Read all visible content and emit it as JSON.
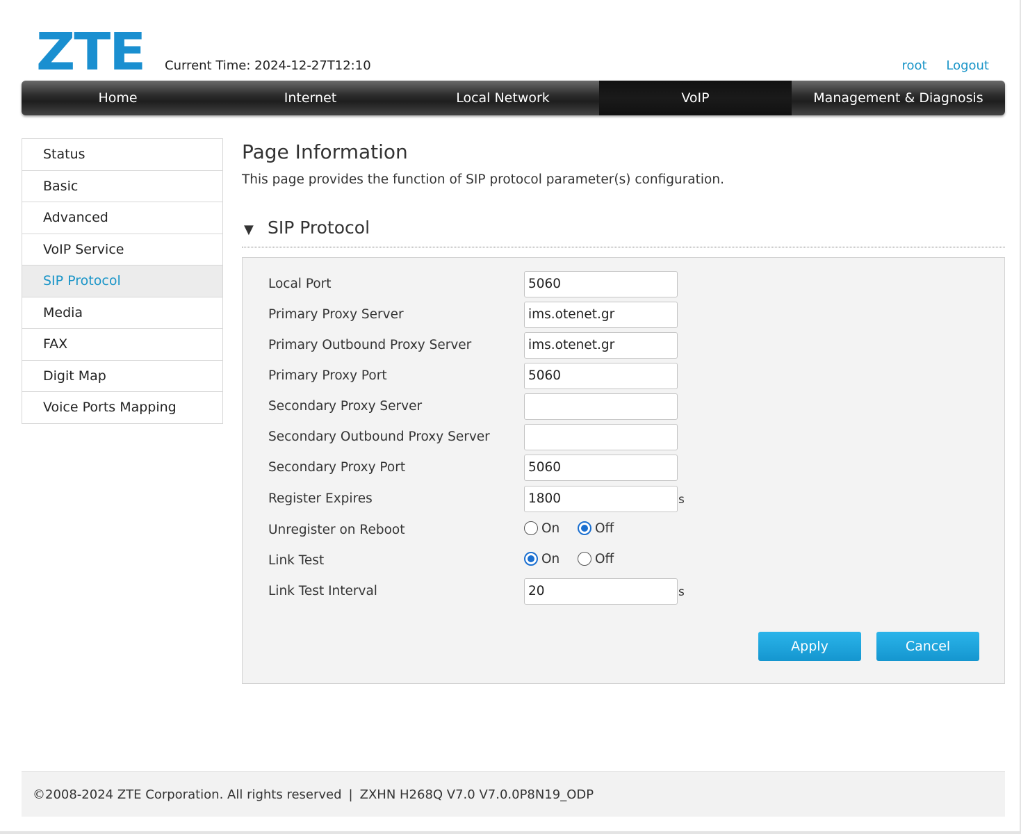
{
  "header": {
    "logo": "ZTE",
    "current_time_label": "Current Time: 2024-12-27T12:10",
    "user": "root",
    "logout": "Logout"
  },
  "nav": {
    "items": [
      {
        "label": "Home"
      },
      {
        "label": "Internet"
      },
      {
        "label": "Local Network"
      },
      {
        "label": "VoIP"
      },
      {
        "label": "Management & Diagnosis"
      }
    ],
    "active": "VoIP"
  },
  "sidebar": {
    "items": [
      {
        "label": "Status"
      },
      {
        "label": "Basic"
      },
      {
        "label": "Advanced"
      },
      {
        "label": "VoIP Service"
      },
      {
        "label": "SIP Protocol"
      },
      {
        "label": "Media"
      },
      {
        "label": "FAX"
      },
      {
        "label": "Digit Map"
      },
      {
        "label": "Voice Ports Mapping"
      }
    ],
    "active": "SIP Protocol"
  },
  "main": {
    "title": "Page Information",
    "description": "This page provides the function of SIP protocol parameter(s) configuration.",
    "section_title": "SIP Protocol",
    "fields": {
      "local_port": {
        "label": "Local Port",
        "value": "5060"
      },
      "primary_proxy_server": {
        "label": "Primary Proxy Server",
        "value": "ims.otenet.gr"
      },
      "primary_outbound_proxy_server": {
        "label": "Primary Outbound Proxy Server",
        "value": "ims.otenet.gr"
      },
      "primary_proxy_port": {
        "label": "Primary Proxy Port",
        "value": "5060"
      },
      "secondary_proxy_server": {
        "label": "Secondary Proxy Server",
        "value": ""
      },
      "secondary_outbound_proxy_server": {
        "label": "Secondary Outbound Proxy Server",
        "value": ""
      },
      "secondary_proxy_port": {
        "label": "Secondary Proxy Port",
        "value": "5060"
      },
      "register_expires": {
        "label": "Register Expires",
        "value": "1800",
        "unit": "s"
      },
      "unregister_on_reboot": {
        "label": "Unregister on Reboot",
        "on_label": "On",
        "off_label": "Off",
        "selected": "Off"
      },
      "link_test": {
        "label": "Link Test",
        "on_label": "On",
        "off_label": "Off",
        "selected": "On"
      },
      "link_test_interval": {
        "label": "Link Test Interval",
        "value": "20",
        "unit": "s"
      }
    },
    "apply_label": "Apply",
    "cancel_label": "Cancel"
  },
  "footer": {
    "copyright": "©2008-2024 ZTE Corporation. All rights reserved",
    "separator": "|",
    "version": "ZXHN H268Q V7.0 V7.0.0P8N19_ODP"
  },
  "colors": {
    "brand": "#1a8fd0",
    "link": "#1a95c8",
    "button": "#1a9fd9",
    "radio_selected": "#1a6fd0"
  }
}
